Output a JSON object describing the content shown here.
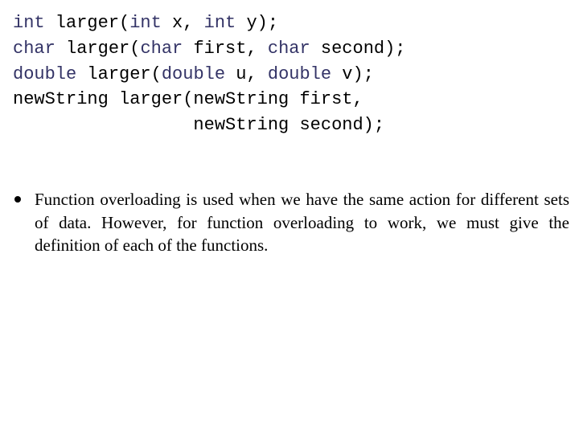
{
  "code": {
    "keyword_color": "#333366",
    "lines": [
      [
        {
          "t": "int",
          "kw": true
        },
        {
          "t": " larger(",
          "kw": false
        },
        {
          "t": "int",
          "kw": true
        },
        {
          "t": " x, ",
          "kw": false
        },
        {
          "t": "int",
          "kw": true
        },
        {
          "t": " y);",
          "kw": false
        }
      ],
      [
        {
          "t": "char",
          "kw": true
        },
        {
          "t": " larger(",
          "kw": false
        },
        {
          "t": "char",
          "kw": true
        },
        {
          "t": " first, ",
          "kw": false
        },
        {
          "t": "char",
          "kw": true
        },
        {
          "t": " second);",
          "kw": false
        }
      ],
      [
        {
          "t": "double",
          "kw": true
        },
        {
          "t": " larger(",
          "kw": false
        },
        {
          "t": "double",
          "kw": true
        },
        {
          "t": " u, ",
          "kw": false
        },
        {
          "t": "double",
          "kw": true
        },
        {
          "t": " v);",
          "kw": false
        }
      ],
      [
        {
          "t": "newString larger(newString first,",
          "kw": false
        }
      ],
      [
        {
          "t": "                 newString second);",
          "kw": false
        }
      ]
    ]
  },
  "bullets": [
    {
      "text": "Function overloading is used when we have the same action for different sets of data. However, for function overloading to work, we must give the definition of each of the functions."
    }
  ]
}
